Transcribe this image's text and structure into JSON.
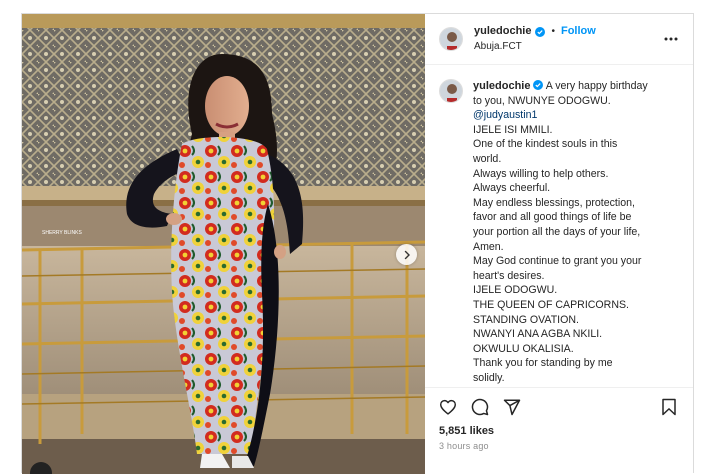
{
  "post": {
    "username": "yuledochie",
    "follow_label": "Follow",
    "separator": "•",
    "location": "Abuja.FCT",
    "photo_watermark": "SHERRY BLINKS",
    "caption_lines": [
      "A very happy birthday",
      "to you, NWUNYE ODOGWU.",
      "@judyaustin1",
      "IJELE ISI MMILI.",
      "One of the kindest souls in this",
      "world.",
      "Always willing to help others.",
      "Always cheerful.",
      "May endless blessings, protection,",
      "favor and all good things of life be",
      "your portion all the days of your life,",
      "Amen.",
      "May God continue to grant you your",
      "heart's desires.",
      "IJELE ODOGWU.",
      "THE QUEEN OF CAPRICORNS.",
      "STANDING OVATION.",
      "NWANYI ANA AGBA NKILI.",
      "OKWULU OKALISIA.",
      "Thank you for standing by me",
      "solidly."
    ],
    "likes": "5,851 likes",
    "time_ago": "3 hours ago"
  },
  "icons": {
    "verified": "verified-badge-icon",
    "more": "more-options-icon",
    "like": "heart-icon",
    "comment": "comment-icon",
    "share": "share-icon",
    "save": "bookmark-icon",
    "next": "chevron-right-icon"
  },
  "colors": {
    "accent": "#0095f6",
    "text": "#262626",
    "muted": "#8e8e8e",
    "mention": "#00376b"
  }
}
